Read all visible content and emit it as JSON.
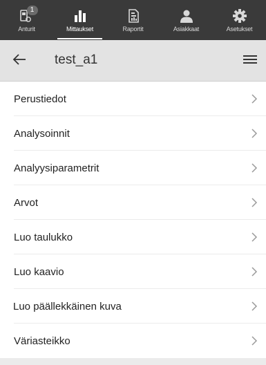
{
  "nav": {
    "tabs": [
      {
        "label": "Anturit",
        "icon": "sensor-icon",
        "badge": "1",
        "active": false
      },
      {
        "label": "Mittaukset",
        "icon": "bar-chart-icon",
        "active": true
      },
      {
        "label": "Raportit",
        "icon": "report-icon",
        "active": false
      },
      {
        "label": "Asiakkaat",
        "icon": "user-icon",
        "active": false
      },
      {
        "label": "Asetukset",
        "icon": "gear-icon",
        "active": false
      }
    ]
  },
  "header": {
    "title": "test_a1",
    "back_icon": "arrow-left-icon",
    "menu_icon": "hamburger-menu-icon"
  },
  "list": {
    "items": [
      {
        "label": "Perustiedot"
      },
      {
        "label": "Analysoinnit"
      },
      {
        "label": "Analyysiparametrit"
      },
      {
        "label": "Arvot"
      },
      {
        "label": "Luo taulukko"
      },
      {
        "label": "Luo kaavio"
      },
      {
        "label": "Luo päällekkäinen kuva"
      },
      {
        "label": "Väriasteikko"
      }
    ]
  },
  "colors": {
    "nav_background": "#3a3a3a",
    "header_background": "#e3e3e3",
    "page_background": "#ebebeb",
    "list_background": "#ffffff",
    "chevron": "#9a9a9a"
  }
}
